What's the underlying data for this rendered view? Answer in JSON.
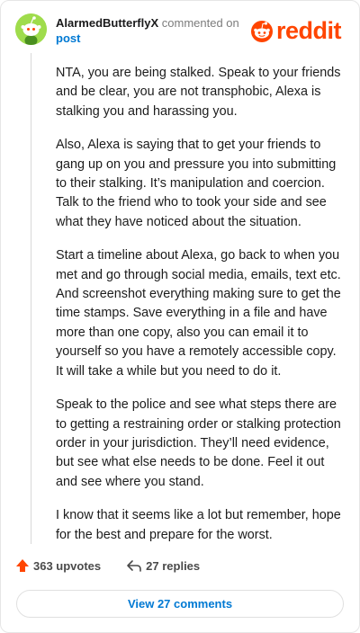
{
  "header": {
    "username": "AlarmedButterflyX",
    "action_text": "commented on",
    "post_link": "post"
  },
  "brand": {
    "wordmark": "reddit",
    "color": "#ff4500"
  },
  "comment": {
    "paragraphs": [
      "NTA, you are being stalked. Speak to your friends and be clear, you are not transphobic, Alexa is stalking you and harassing you.",
      "Also, Alexa is saying that to get your friends to gang up on you and pressure you into submitting to their stalking. It’s manipulation and coercion. Talk to the friend who to took your side and see what they have noticed about the situation.",
      "Start a timeline about Alexa, go back to when you met and go through social media, emails, text etc. And screenshot everything making sure to get the time stamps. Save everything in a file and have more than one copy, also you can email it to yourself so you have a remotely accessible copy. It will take a while but you need to do it.",
      "Speak to the police and see what steps there are to getting a restraining order or stalking protection order in your jurisdiction. They’ll need evidence, but see what else needs to be done. Feel it out and see where you stand.",
      "I know that it seems like a lot but remember, hope for the best and prepare for the worst."
    ]
  },
  "footer": {
    "upvotes": "363 upvotes",
    "replies": "27 replies"
  },
  "view_comments": {
    "label": "View 27 comments"
  },
  "icons": {
    "avatar": "snoo-avatar-icon",
    "upvote": "upvote-arrow-icon",
    "reply": "reply-arrow-icon",
    "logo": "reddit-snoo-logo-icon"
  },
  "colors": {
    "accent_blue": "#0079d3",
    "avatar_green": "#9fdc4c",
    "upvote_orange": "#ff4500"
  }
}
